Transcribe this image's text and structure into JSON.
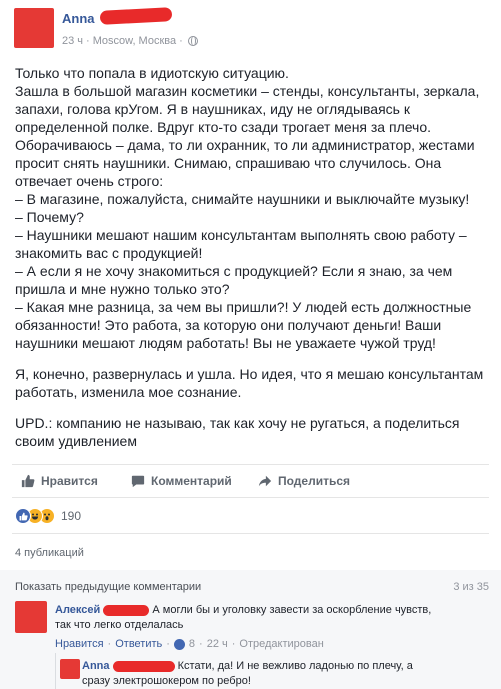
{
  "post": {
    "author": "Anna",
    "time": "23 ч",
    "location": "Moscow, Москва",
    "text_lines": [
      "Только что попала в идиотскую ситуацию.",
      "Зашла в большой магазин косметики – стенды, консультанты, зеркала,",
      "запахи, голова крУгом. Я в наушниках, иду не оглядываясь к",
      "определенной полке. Вдруг кто-то сзади трогает меня за плечо.",
      "Оборачиваюсь – дама, то ли охранник, то ли администратор, жестами",
      "просит снять наушники. Снимаю, спрашиваю что случилось. Она",
      "отвечает очень строго:",
      "– В магазине, пожалуйста, снимайте наушники и выключайте музыку!",
      "– Почему?",
      "– Наушники мешают нашим консультантам выполнять свою работу –",
      "знакомить вас с продукцией!",
      "– А если я не хочу знакомиться с продукцией? Если я знаю, за чем",
      "пришла и мне нужно только это?",
      "– Какая мне разница, за чем вы пришли?! У людей есть должностные",
      "обязанности! Это работа, за которую они получают деньги! Ваши",
      "наушники мешают людям работать! Вы не уважаете чужой труд!"
    ],
    "text_lines_2": [
      "Я, конечно, развернулась и ушла. Но идея, что я мешаю консультантам",
      "работать, изменила мое сознание."
    ],
    "text_lines_3": [
      "UPD.: компанию не называю, так как хочу не ругаться, а поделиться",
      "своим удивлением"
    ]
  },
  "actions": {
    "like_label": "Нравится",
    "comment_label": "Комментарий",
    "share_label": "Поделиться"
  },
  "reactions": {
    "count": "190",
    "types": [
      "like-icon",
      "haha-icon",
      "wow-icon"
    ]
  },
  "shares": "4 публикаций",
  "comments": {
    "show_previous": "Показать предыдущие комментарии",
    "position": "3 из 35",
    "items": [
      {
        "author": "Алексей",
        "text_line1": "А могли бы и уголовку завести за оскорбление чувств,",
        "text_line2": "так что легко отделалась",
        "like": "Нравится",
        "reply": "Ответить",
        "likes": "8",
        "time": "22 ч",
        "edited": "Отредактирован"
      },
      {
        "author": "Anna",
        "text_line1": "Кстати, да! И не вежливо ладонью по плечу, а",
        "text_line2": "сразу электрошокером по ребро!"
      }
    ]
  },
  "colors": {
    "link": "#365899",
    "redaction": "#e82a2a",
    "muted": "#90949c"
  }
}
